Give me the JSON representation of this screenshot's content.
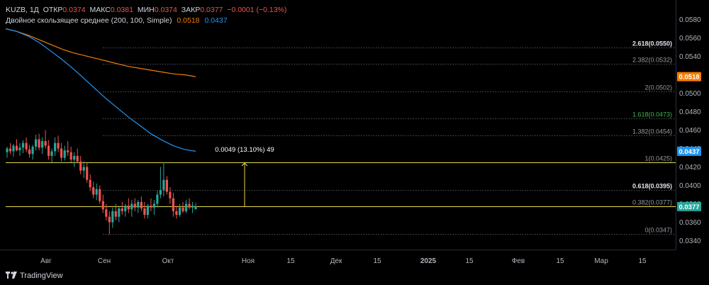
{
  "legend": {
    "symbol": "KUZB, 1Д",
    "open_label": "ОТКР",
    "open": "0.0374",
    "high_label": "МАКС",
    "high": "0.0381",
    "low_label": "МИН",
    "low": "0.0374",
    "close_label": "ЗАКР",
    "close": "0.0377",
    "change": "−0.0001 (−0.13%)",
    "ma_title": "Двойное скользящее среднее (200, 100, Simple)",
    "ma1_value": "0.0518",
    "ma2_value": "0.0437"
  },
  "footer": {
    "brand": "TradingView"
  },
  "measure_label": "0.0049 (13.10%) 49",
  "colors": {
    "up": "#26a69a",
    "down": "#ef5350",
    "ma200": "#f57c00",
    "ma100": "#2196f3",
    "fib_line": "#e6d84a",
    "grid": "#1e222d",
    "axis_text": "#b2b5be"
  },
  "chart_data": {
    "type": "candlestick",
    "title": "KUZB, 1Д",
    "x_ticks": [
      "Авг",
      "Сен",
      "Окт",
      "Ноя",
      "15",
      "Дек",
      "15",
      "2025",
      "15",
      "Фев",
      "15",
      "Мар",
      "15"
    ],
    "y_ticks": [
      "0.0580",
      "0.0560",
      "0.0540",
      "0.0520",
      "0.0500",
      "0.0480",
      "0.0460",
      "0.0440",
      "0.0420",
      "0.0400",
      "0.0380",
      "0.0360",
      "0.0340"
    ],
    "ylim": [
      0.0332,
      0.0588
    ],
    "price_tags": [
      {
        "value": "0.0518",
        "color": "#f57c00"
      },
      {
        "value": "0.0437",
        "color": "#2196f3"
      },
      {
        "value": "0.0377",
        "color": "#26a69a"
      }
    ],
    "fib_levels": [
      {
        "ratio": "2.618",
        "price": 0.055,
        "label": "2.618(0.0550)"
      },
      {
        "ratio": "2.382",
        "price": 0.0532,
        "label": "2.382(0.0532)"
      },
      {
        "ratio": "2",
        "price": 0.0502,
        "label": "2(0.0502)"
      },
      {
        "ratio": "1.618",
        "price": 0.0473,
        "label": "1.618(0.0473)"
      },
      {
        "ratio": "1.382",
        "price": 0.0454,
        "label": "1.382(0.0454)"
      },
      {
        "ratio": "1",
        "price": 0.0425,
        "label": "1(0.0425)"
      },
      {
        "ratio": "0.618",
        "price": 0.0395,
        "label": "0.618(0.0395)"
      },
      {
        "ratio": "0.382",
        "price": 0.0377,
        "label": "0.382(0.0377)"
      },
      {
        "ratio": "0",
        "price": 0.0347,
        "label": "0(0.0347)"
      }
    ],
    "ma200": [
      0.057,
      0.0567,
      0.0563,
      0.0558,
      0.0553,
      0.0548,
      0.0544,
      0.0541,
      0.0538,
      0.0535,
      0.0532,
      0.0529,
      0.0527,
      0.0525,
      0.0523,
      0.0521,
      0.052,
      0.0518
    ],
    "ma100": [
      0.057,
      0.0567,
      0.0562,
      0.0555,
      0.0546,
      0.0537,
      0.0527,
      0.0516,
      0.0505,
      0.0494,
      0.0484,
      0.0474,
      0.0465,
      0.0456,
      0.0449,
      0.0443,
      0.0439,
      0.0437
    ],
    "candles": [
      [
        0.0436,
        0.0442,
        0.043,
        0.044
      ],
      [
        0.044,
        0.0446,
        0.0434,
        0.0437
      ],
      [
        0.0437,
        0.0445,
        0.0431,
        0.0443
      ],
      [
        0.0443,
        0.045,
        0.0437,
        0.0438
      ],
      [
        0.0438,
        0.0446,
        0.0432,
        0.0441
      ],
      [
        0.0441,
        0.0449,
        0.0435,
        0.0446
      ],
      [
        0.0446,
        0.0452,
        0.0436,
        0.0439
      ],
      [
        0.0439,
        0.0444,
        0.043,
        0.0434
      ],
      [
        0.0434,
        0.0444,
        0.0428,
        0.0442
      ],
      [
        0.0442,
        0.0455,
        0.0438,
        0.045
      ],
      [
        0.045,
        0.0456,
        0.0438,
        0.0441
      ],
      [
        0.0441,
        0.0452,
        0.0434,
        0.0448
      ],
      [
        0.0448,
        0.046,
        0.044,
        0.0443
      ],
      [
        0.0443,
        0.0449,
        0.0428,
        0.0432
      ],
      [
        0.0432,
        0.044,
        0.0425,
        0.0437
      ],
      [
        0.0437,
        0.0452,
        0.0432,
        0.0446
      ],
      [
        0.0446,
        0.0454,
        0.0436,
        0.044
      ],
      [
        0.044,
        0.0446,
        0.0426,
        0.043
      ],
      [
        0.043,
        0.0443,
        0.0427,
        0.0438
      ],
      [
        0.0438,
        0.0448,
        0.0432,
        0.0436
      ],
      [
        0.0436,
        0.0442,
        0.0425,
        0.0428
      ],
      [
        0.0428,
        0.0436,
        0.042,
        0.0432
      ],
      [
        0.0432,
        0.044,
        0.0424,
        0.0426
      ],
      [
        0.0426,
        0.0432,
        0.0412,
        0.0416
      ],
      [
        0.0416,
        0.0426,
        0.0408,
        0.042
      ],
      [
        0.042,
        0.0424,
        0.0403,
        0.0406
      ],
      [
        0.0406,
        0.0412,
        0.0394,
        0.0398
      ],
      [
        0.0398,
        0.0404,
        0.0386,
        0.039
      ],
      [
        0.039,
        0.0402,
        0.0384,
        0.0396
      ],
      [
        0.0396,
        0.04,
        0.038,
        0.0383
      ],
      [
        0.0383,
        0.039,
        0.037,
        0.0374
      ],
      [
        0.0374,
        0.038,
        0.0362,
        0.0366
      ],
      [
        0.0366,
        0.0372,
        0.0347,
        0.036
      ],
      [
        0.036,
        0.0376,
        0.0354,
        0.0372
      ],
      [
        0.0372,
        0.038,
        0.0362,
        0.0366
      ],
      [
        0.0366,
        0.0378,
        0.036,
        0.0375
      ],
      [
        0.0375,
        0.0382,
        0.0368,
        0.0372
      ],
      [
        0.0372,
        0.038,
        0.0366,
        0.0378
      ],
      [
        0.0378,
        0.0386,
        0.037,
        0.0374
      ],
      [
        0.0374,
        0.0384,
        0.0366,
        0.038
      ],
      [
        0.038,
        0.0386,
        0.0372,
        0.0376
      ],
      [
        0.0376,
        0.0384,
        0.037,
        0.0382
      ],
      [
        0.0382,
        0.0388,
        0.0372,
        0.0375
      ],
      [
        0.0375,
        0.0382,
        0.0364,
        0.0368
      ],
      [
        0.0368,
        0.038,
        0.0364,
        0.0378
      ],
      [
        0.0378,
        0.0386,
        0.0372,
        0.0376
      ],
      [
        0.0376,
        0.0384,
        0.0368,
        0.038
      ],
      [
        0.038,
        0.0394,
        0.0376,
        0.039
      ],
      [
        0.039,
        0.042,
        0.0386,
        0.0395
      ],
      [
        0.0395,
        0.0425,
        0.0388,
        0.0406
      ],
      [
        0.0406,
        0.041,
        0.039,
        0.0393
      ],
      [
        0.0393,
        0.0398,
        0.038,
        0.0386
      ],
      [
        0.0386,
        0.0392,
        0.0366,
        0.0372
      ],
      [
        0.0372,
        0.0378,
        0.0364,
        0.0368
      ],
      [
        0.0368,
        0.038,
        0.0366,
        0.0376
      ],
      [
        0.0376,
        0.0382,
        0.037,
        0.0372
      ],
      [
        0.0372,
        0.0384,
        0.037,
        0.038
      ],
      [
        0.038,
        0.0386,
        0.0374,
        0.0376
      ],
      [
        0.0376,
        0.0382,
        0.037,
        0.0378
      ],
      [
        0.0374,
        0.0381,
        0.0374,
        0.0377
      ]
    ]
  }
}
